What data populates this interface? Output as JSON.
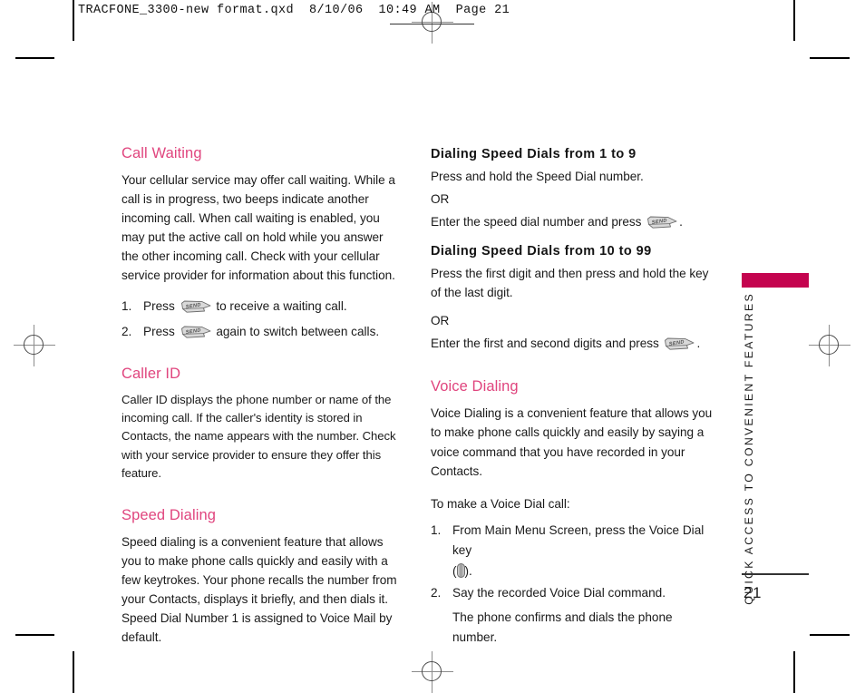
{
  "page": {
    "slug": "TRACFONE_3300-new format.qxd  8/10/06  10:49 AM  Page 21",
    "folio": "21",
    "running_head": "QUICK ACCESS TO CONVENIENT FEATURES",
    "accent_bar_color": "#c4044f",
    "heading_color": "#e0457e"
  },
  "left_column": {
    "call_waiting": {
      "heading": "Call Waiting",
      "paragraph": "Your cellular service may offer call waiting. While a call is in progress, two beeps indicate another incoming call. When call waiting is enabled, you may put the active call on hold while you answer the other incoming call. Check with your cellular service provider for information about this function.",
      "steps": [
        {
          "num": "1.",
          "before": "Press",
          "icon": "send-key-icon",
          "after": "to receive a waiting call."
        },
        {
          "num": "2.",
          "before": "Press",
          "icon": "send-key-icon",
          "after": "again to switch between calls."
        }
      ]
    },
    "caller_id": {
      "heading": "Caller ID",
      "paragraph": "Caller ID displays the phone number or name of the incoming call. If the caller's identity is stored in Contacts, the name appears with the number. Check with your service provider to ensure they offer this feature."
    },
    "speed_dialing": {
      "heading": "Speed Dialing",
      "paragraph": "Speed dialing is a convenient feature that allows you to make phone calls quickly and easily with a few keytrokes. Your phone recalls the number from your Contacts, displays it briefly, and then dials it. Speed Dial Number 1 is assigned to Voice Mail by default."
    }
  },
  "right_column": {
    "dials_1_to_9": {
      "heading": "Dialing Speed Dials from 1 to 9",
      "line1": "Press and hold the Speed Dial number.",
      "line2": "OR",
      "line3_before": "Enter the speed dial number and press",
      "line3_icon": "send-key-icon",
      "line3_after": "."
    },
    "dials_10_to_99": {
      "heading": "Dialing Speed Dials from 10 to 99",
      "line1": "Press the first digit and then press and hold the key of the last digit.",
      "line2": "OR",
      "line3_before": "Enter the first and second digits and press",
      "line3_icon": "send-key-icon",
      "line3_after": "."
    },
    "voice_dialing": {
      "heading": "Voice Dialing",
      "paragraph": "Voice Dialing is a convenient feature that allows you to make phone calls quickly and easily by saying a voice command that you have recorded in your Contacts.",
      "intro": "To make a Voice Dial call:",
      "steps": [
        {
          "num": "1.",
          "text": "From Main Menu Screen, press the Voice Dial key",
          "sub_before": "(",
          "sub_icon": "voice-dial-side-key-icon",
          "sub_after": ")."
        },
        {
          "num": "2.",
          "text": "Say the recorded Voice Dial command.",
          "note": "The phone confirms and dials the phone number."
        }
      ]
    }
  },
  "send_key_label": "SEND"
}
